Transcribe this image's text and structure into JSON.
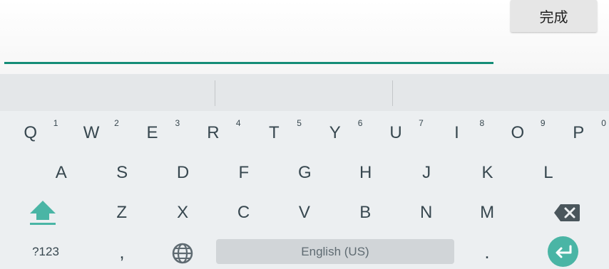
{
  "input": {
    "value": "",
    "placeholder": ""
  },
  "done_label": "完成",
  "keyboard": {
    "row1": [
      {
        "label": "Q",
        "hint": "1"
      },
      {
        "label": "W",
        "hint": "2"
      },
      {
        "label": "E",
        "hint": "3"
      },
      {
        "label": "R",
        "hint": "4"
      },
      {
        "label": "T",
        "hint": "5"
      },
      {
        "label": "Y",
        "hint": "6"
      },
      {
        "label": "U",
        "hint": "7"
      },
      {
        "label": "I",
        "hint": "8"
      },
      {
        "label": "O",
        "hint": "9"
      },
      {
        "label": "P",
        "hint": "0"
      }
    ],
    "row2": [
      "A",
      "S",
      "D",
      "F",
      "G",
      "H",
      "J",
      "K",
      "L"
    ],
    "row3": [
      "Z",
      "X",
      "C",
      "V",
      "B",
      "N",
      "M"
    ],
    "symbols_label": "?123",
    "comma_label": ",",
    "period_label": ".",
    "space_label": "English (US)",
    "icons": {
      "shift": "shift-arrow-icon",
      "delete": "backspace-icon",
      "language": "globe-icon",
      "enter": "enter-return-icon"
    },
    "colors": {
      "accent": "#148d77",
      "shift": "#4ab5a5",
      "enter_bg": "#4ab5a5",
      "key_text": "#37474f",
      "keyboard_bg": "#eceff1"
    }
  }
}
